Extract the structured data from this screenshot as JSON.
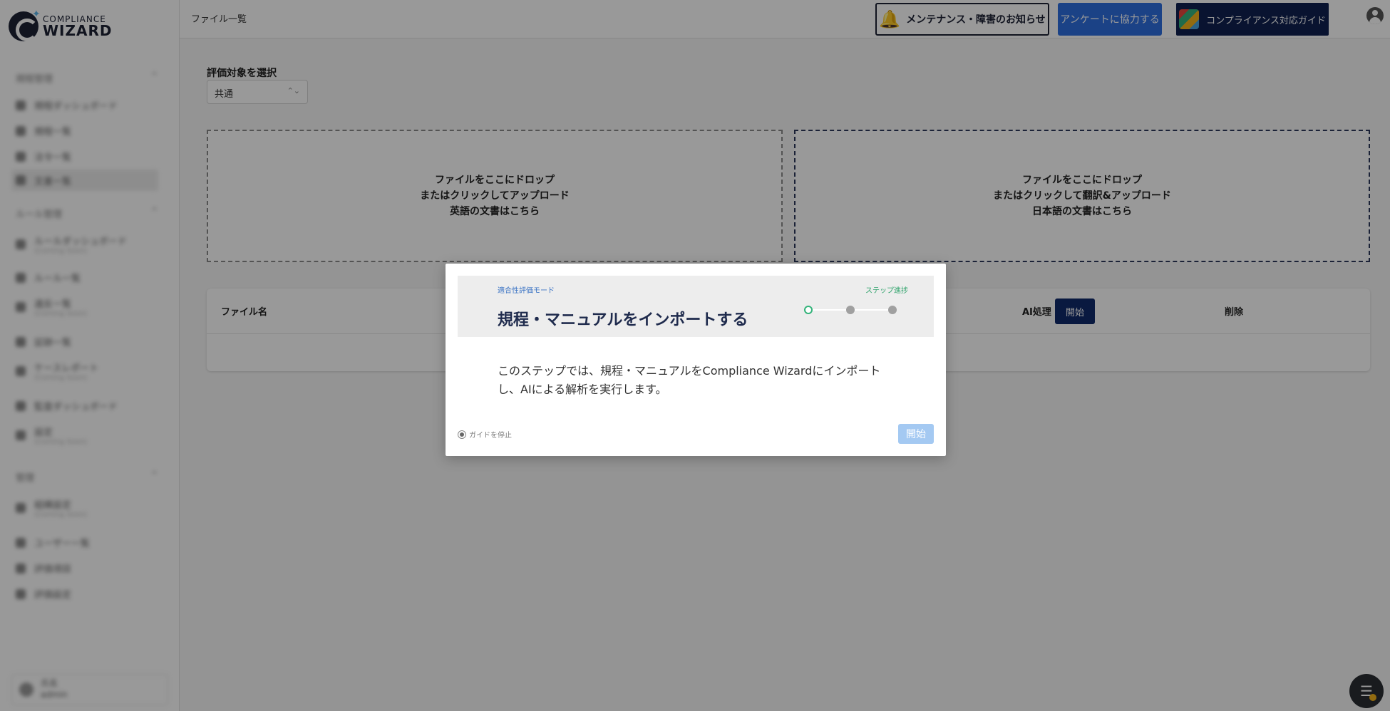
{
  "brand": {
    "line1": "COMPLIANCE",
    "line2": "WIZARD"
  },
  "sidebar": {
    "sections": [
      {
        "label": "規程管理",
        "items": [
          {
            "label": "規程ダッシュボード",
            "sub": ""
          },
          {
            "label": "規程一覧",
            "sub": ""
          },
          {
            "label": "法令一覧",
            "sub": ""
          },
          {
            "label": "文書一覧",
            "sub": ""
          }
        ]
      },
      {
        "label": "ルール管理",
        "items": [
          {
            "label": "ルールダッシュボード",
            "sub": "(Coming Soon)"
          },
          {
            "label": "ルール一覧",
            "sub": ""
          },
          {
            "label": "違反一覧",
            "sub": "(Coming Soon)"
          },
          {
            "label": "証跡一覧",
            "sub": ""
          },
          {
            "label": "ケースレポート",
            "sub": "(Coming Soon)"
          },
          {
            "label": "監査ダッシュボード",
            "sub": ""
          },
          {
            "label": "設定",
            "sub": "(Coming Soon)"
          }
        ]
      },
      {
        "label": "管理",
        "items": [
          {
            "label": "組織設定",
            "sub": "(Coming Soon)"
          },
          {
            "label": "ユーザー一覧",
            "sub": ""
          },
          {
            "label": "評価項目",
            "sub": ""
          },
          {
            "label": "評価設定",
            "sub": ""
          }
        ]
      }
    ],
    "user": {
      "name": "氏名",
      "role": "admin"
    }
  },
  "header": {
    "title": "ファイル一覧",
    "maintenance_label": "メンテナンス・障害のお知らせ",
    "survey_label": "アンケートに協力する",
    "guide_label": "コンプライアンス対応ガイド"
  },
  "main": {
    "eval_label": "評価対象を選択",
    "eval_value": "共通",
    "dropzone_en": {
      "line1": "ファイルをここにドロップ",
      "line2": "またはクリックしてアップロード",
      "line3": "英語の文書はこちら"
    },
    "dropzone_ja": {
      "line1": "ファイルをここにドロップ",
      "line2": "またはクリックして翻訳&アップロード",
      "line3": "日本語の文書はこちら"
    },
    "table": {
      "col_file": "ファイル名",
      "col_ai": "AI処理",
      "ai_start": "開始",
      "col_delete": "削除"
    }
  },
  "modal": {
    "mode_label": "適合性評価モード",
    "step_label": "ステップ進捗",
    "title": "規程・マニュアルをインポートする",
    "body_line1": "このステップでは、規程・マニュアルをCompliance Wizardにインポート",
    "body_line2": "し、AIによる解析を実行します。",
    "stop_label": "ガイドを停止",
    "start_label": "開始",
    "steps_total": 3,
    "steps_current": 1
  },
  "colors": {
    "brand_navy": "#0f2050",
    "survey_blue": "#2d6fe0",
    "step_green": "#34b37a",
    "bell_yellow": "#f0b400"
  }
}
